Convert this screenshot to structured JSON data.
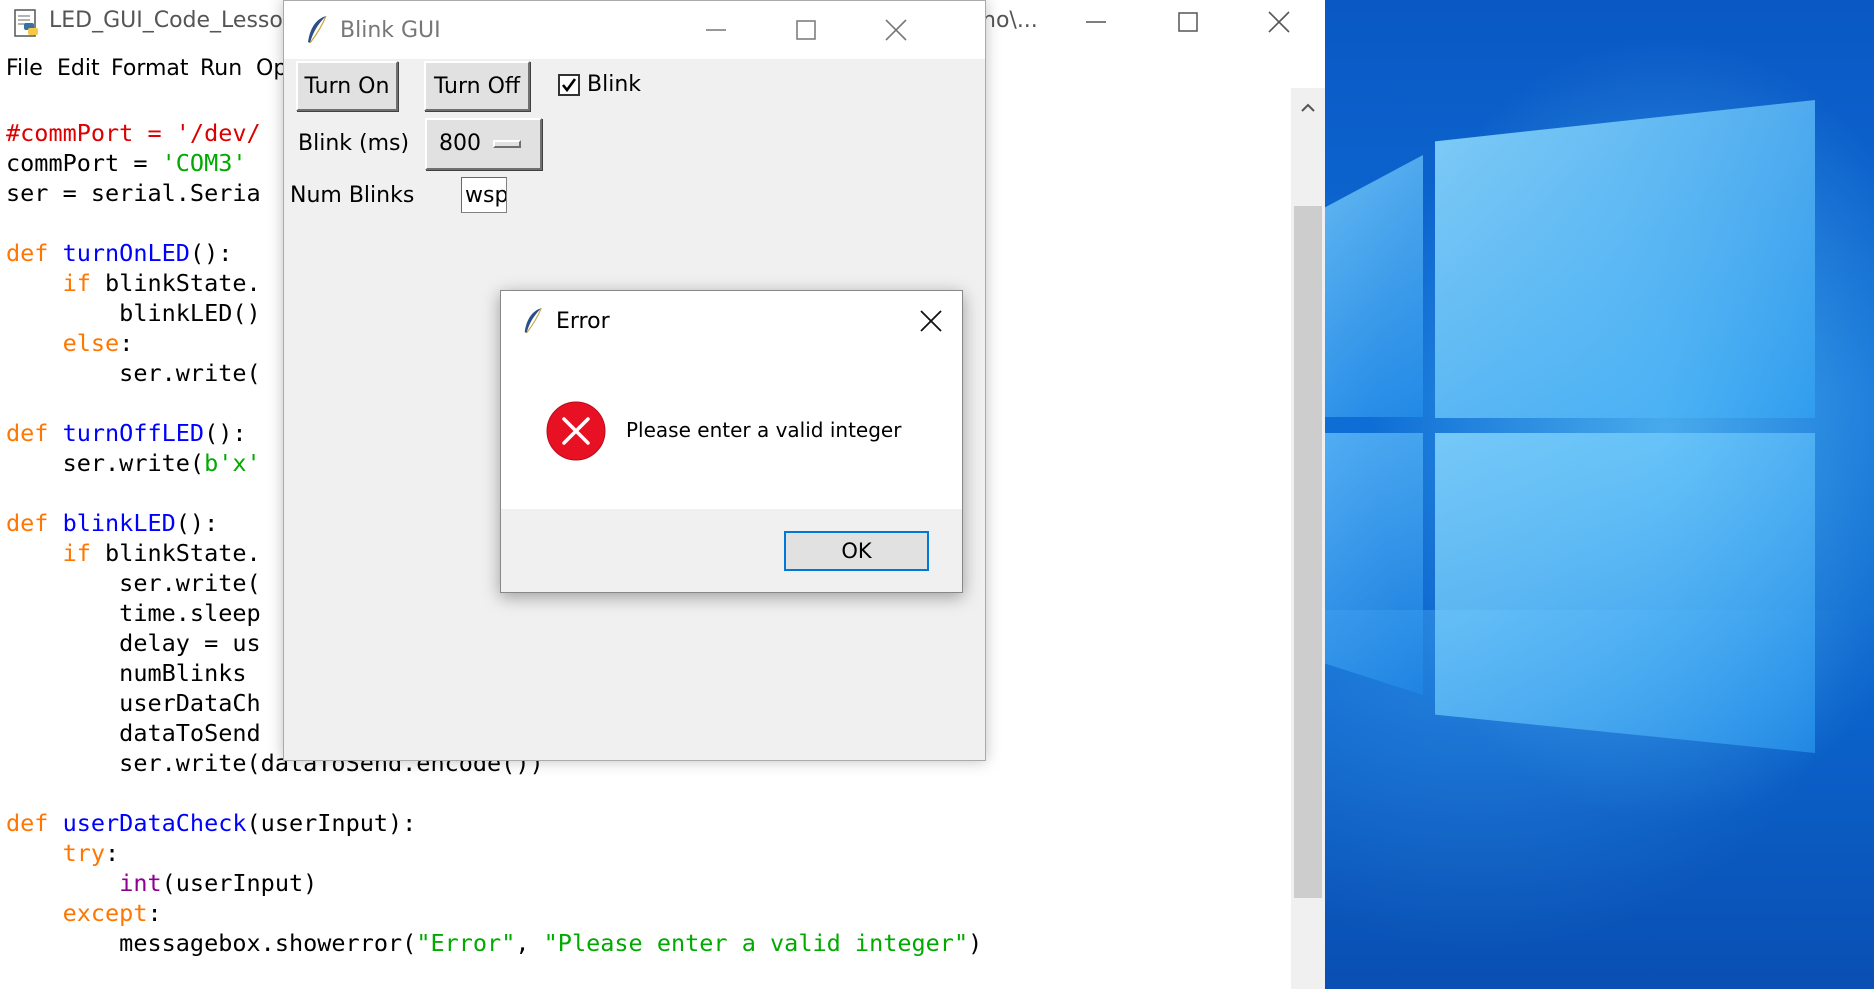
{
  "idle": {
    "title": "LED_GUI_Code_Lesson",
    "title_tail": "no\\...",
    "menu": [
      "File",
      "Edit",
      "Format",
      "Run",
      "Op"
    ],
    "code_lines": [
      [
        {
          "t": "#commPort = '/dev/",
          "c": "cm"
        }
      ],
      [
        {
          "t": "commPort = "
        },
        {
          "t": "'COM3'",
          "c": "st"
        }
      ],
      [
        {
          "t": "ser = serial.Seria"
        }
      ],
      [],
      [
        {
          "t": "def ",
          "c": "kw"
        },
        {
          "t": "turnOnLED",
          "c": "fn"
        },
        {
          "t": "():"
        }
      ],
      [
        {
          "t": "    "
        },
        {
          "t": "if ",
          "c": "kw"
        },
        {
          "t": "blinkState."
        }
      ],
      [
        {
          "t": "        blinkLED()"
        }
      ],
      [
        {
          "t": "    "
        },
        {
          "t": "else",
          "c": "kw"
        },
        {
          "t": ":"
        }
      ],
      [
        {
          "t": "        ser.write("
        }
      ],
      [],
      [
        {
          "t": "def ",
          "c": "kw"
        },
        {
          "t": "turnOffLED",
          "c": "fn"
        },
        {
          "t": "():"
        }
      ],
      [
        {
          "t": "    ser.write("
        },
        {
          "t": "b'x'",
          "c": "st"
        }
      ],
      [],
      [
        {
          "t": "def ",
          "c": "kw"
        },
        {
          "t": "blinkLED",
          "c": "fn"
        },
        {
          "t": "():"
        }
      ],
      [
        {
          "t": "    "
        },
        {
          "t": "if ",
          "c": "kw"
        },
        {
          "t": "blinkState."
        }
      ],
      [
        {
          "t": "        ser.write("
        }
      ],
      [
        {
          "t": "        time.sleep"
        }
      ],
      [
        {
          "t": "        delay = us"
        }
      ],
      [
        {
          "t": "        numBlinks"
        }
      ],
      [
        {
          "t": "        userDataCh"
        }
      ],
      [
        {
          "t": "        dataToSend"
        }
      ],
      [
        {
          "t": "        ser.write(dataToSend.encode())"
        }
      ],
      [],
      [
        {
          "t": "def ",
          "c": "kw"
        },
        {
          "t": "userDataCheck",
          "c": "fn"
        },
        {
          "t": "(userInput):"
        }
      ],
      [
        {
          "t": "    "
        },
        {
          "t": "try",
          "c": "kw"
        },
        {
          "t": ":"
        }
      ],
      [
        {
          "t": "        "
        },
        {
          "t": "int",
          "c": "bi"
        },
        {
          "t": "(userInput)"
        }
      ],
      [
        {
          "t": "    "
        },
        {
          "t": "except",
          "c": "kw"
        },
        {
          "t": ":"
        }
      ],
      [
        {
          "t": "        messagebox.showerror("
        },
        {
          "t": "\"Error\"",
          "c": "st"
        },
        {
          "t": ", "
        },
        {
          "t": "\"Please enter a valid integer\"",
          "c": "st"
        },
        {
          "t": ")"
        }
      ]
    ]
  },
  "blink_gui": {
    "title": "Blink GUI",
    "turn_on_label": "Turn On",
    "turn_off_label": "Turn Off",
    "blink_checkbox_label": "Blink",
    "blink_checked": true,
    "blink_ms_label": "Blink (ms)",
    "blink_ms_value": "800",
    "num_blinks_label": "Num Blinks",
    "num_blinks_value": "wsp"
  },
  "error_dialog": {
    "title": "Error",
    "message": "Please enter a valid integer",
    "ok_label": "OK",
    "icon": "error-icon"
  },
  "colors": {
    "keyword": "#ff7700",
    "function": "#0000ff",
    "string": "#00aa00",
    "comment": "#dd0000",
    "builtin": "#900090",
    "dialog_focus": "#0078d7",
    "error_red": "#e81123",
    "desktop_blue": "#0b64cc"
  }
}
